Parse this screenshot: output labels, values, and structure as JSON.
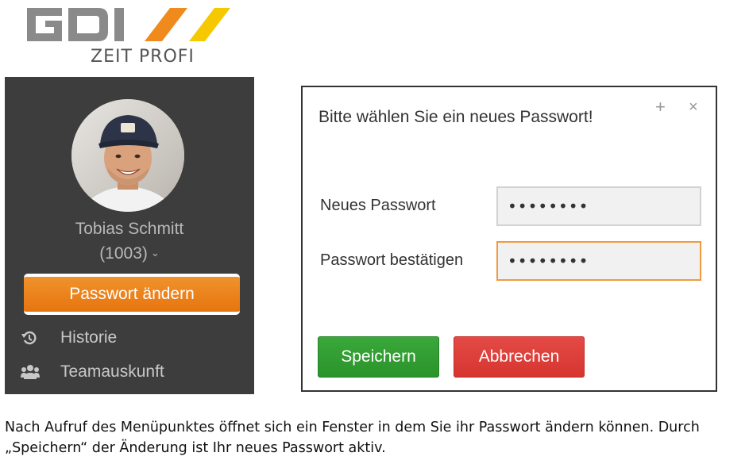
{
  "logo": {
    "brand": "GDI",
    "subtitle": "ZEIT PROFI",
    "colors": {
      "gray": "#8a8a8a",
      "orange": "#f08a1c",
      "yellow": "#f5c800"
    }
  },
  "sidebar": {
    "background": "#3d3d3d",
    "user_name": "Tobias Schmitt",
    "user_id": "(1003)",
    "change_password_label": "Passwort ändern",
    "items": [
      {
        "label": "Historie",
        "icon": "history-icon"
      },
      {
        "label": "Teamauskunft",
        "icon": "team-icon"
      }
    ]
  },
  "dialog": {
    "title": "Bitte wählen Sie ein neues Passwort!",
    "plus_glyph": "+",
    "close_glyph": "×",
    "new_password_label": "Neues Passwort",
    "new_password_value": "••••••••",
    "confirm_password_label": "Passwort bestätigen",
    "confirm_password_value": "••••••••",
    "save_label": "Speichern",
    "cancel_label": "Abbrechen"
  },
  "caption": {
    "line1": "Nach Aufruf des Menüpunktes öffnet sich ein Fenster in dem Sie ihr Passwort ändern können. Durch",
    "line2": "„Speichern“ der Änderung ist Ihr neues Passwort aktiv."
  }
}
